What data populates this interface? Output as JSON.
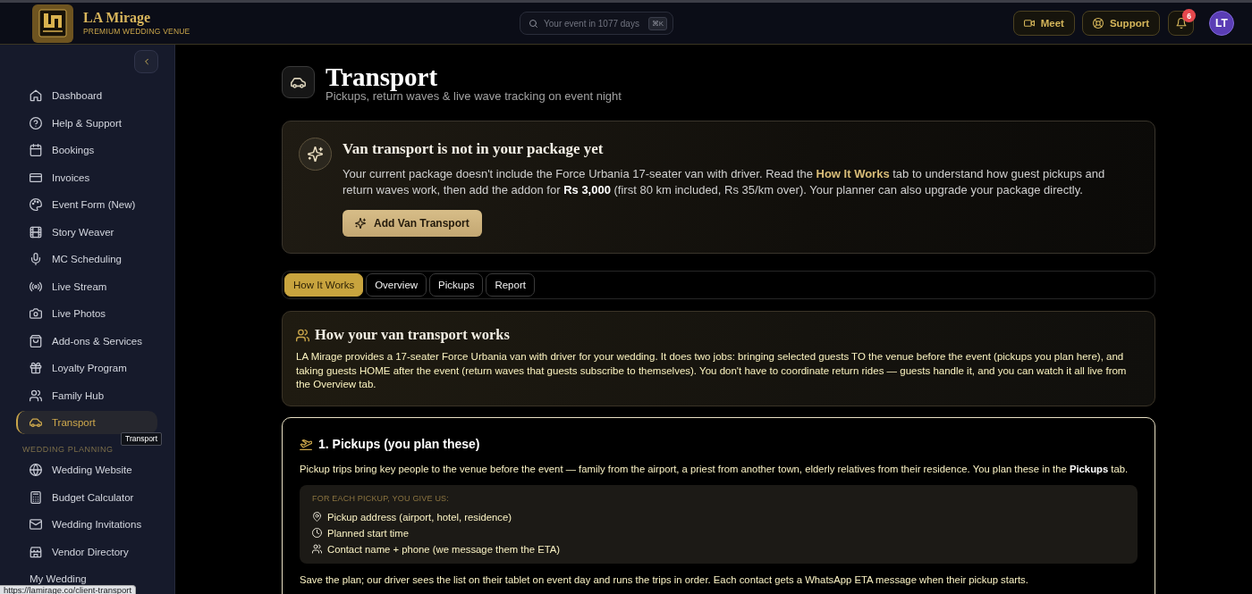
{
  "topbar": {
    "brand": {
      "name": "LA Mirage",
      "tagline": "PREMIUM WEDDING VENUE"
    },
    "search": {
      "placeholder": "Your event in 1077 days",
      "shortcut": "⌘K"
    },
    "buttons": [
      {
        "label": "Meet"
      },
      {
        "label": "Support"
      }
    ],
    "notifications": {
      "count": "6"
    },
    "avatar": {
      "initials": "LT"
    }
  },
  "sidebar": {
    "tooltip": "Transport",
    "sections": [
      {
        "items": [
          {
            "label": "Dashboard",
            "selected": false
          },
          {
            "label": "Help & Support",
            "selected": false
          },
          {
            "label": "Bookings",
            "selected": false
          },
          {
            "label": "Invoices",
            "selected": false
          },
          {
            "label": "Event Form (New)",
            "selected": false
          },
          {
            "label": "Story Weaver",
            "selected": false
          },
          {
            "label": "MC Scheduling",
            "selected": false
          },
          {
            "label": "Live Stream",
            "selected": false
          },
          {
            "label": "Live Photos",
            "selected": false
          },
          {
            "label": "Add-ons & Services",
            "selected": false
          },
          {
            "label": "Loyalty Program",
            "selected": false
          },
          {
            "label": "Family Hub",
            "selected": false
          },
          {
            "label": "Transport",
            "selected": true
          }
        ]
      },
      {
        "heading": "WEDDING PLANNING",
        "items": [
          {
            "label": "Wedding Website",
            "selected": false
          },
          {
            "label": "Budget Calculator",
            "selected": false
          },
          {
            "label": "Wedding Invitations",
            "selected": false
          },
          {
            "label": "Vendor Directory",
            "selected": false
          },
          {
            "label": "My Wedding",
            "selected": false
          }
        ]
      }
    ]
  },
  "page": {
    "title": "Transport",
    "subtitle": "Pickups, return waves & live wave tracking on event night"
  },
  "notice": {
    "title": "Van transport is not in your package yet",
    "text": "Your current package doesn't include the Force Urbania 17-seater van with driver. Read the **How It Works** tab to understand how guest pickups and return waves work, then add the addon for **Rs 3,000** (first 80 km included, Rs 35/km over). Your planner can also upgrade your package directly.",
    "button": "Add Van Transport"
  },
  "tabs": [
    {
      "label": "How It Works",
      "selected": true
    },
    {
      "label": "Overview",
      "selected": false
    },
    {
      "label": "Pickups",
      "selected": false
    },
    {
      "label": "Report",
      "selected": false
    }
  ],
  "explainer": {
    "title": "How your van transport works",
    "text": "LA Mirage provides a 17-seater Force Urbania van with driver for your wedding. It does two jobs: bringing selected guests TO the venue before the event (pickups you plan here), and taking guests HOME after the event (return waves that guests subscribe to themselves). You don't have to coordinate return rides — guests handle it, and you can watch it all live from the Overview tab."
  },
  "pickups": {
    "title": "1. Pickups (you plan these)",
    "text": "Pickup trips bring key people to the venue before the event — family from the airport, a priest from another town, elderly relatives from their residence. You plan these in the **Pickups** tab.",
    "checklist": {
      "heading": "FOR EACH PICKUP, YOU GIVE US:",
      "items": [
        "Pickup address (airport, hotel, residence)",
        "Planned start time",
        "Contact name + phone (we message them the ETA)"
      ]
    },
    "footer": "Save the plan; our driver sees the list on their tablet on event day and runs the trips in order. Each contact gets a WhatsApp ETA message when their pickup starts."
  },
  "status_url": "https://lamirage.co/client-transport"
}
